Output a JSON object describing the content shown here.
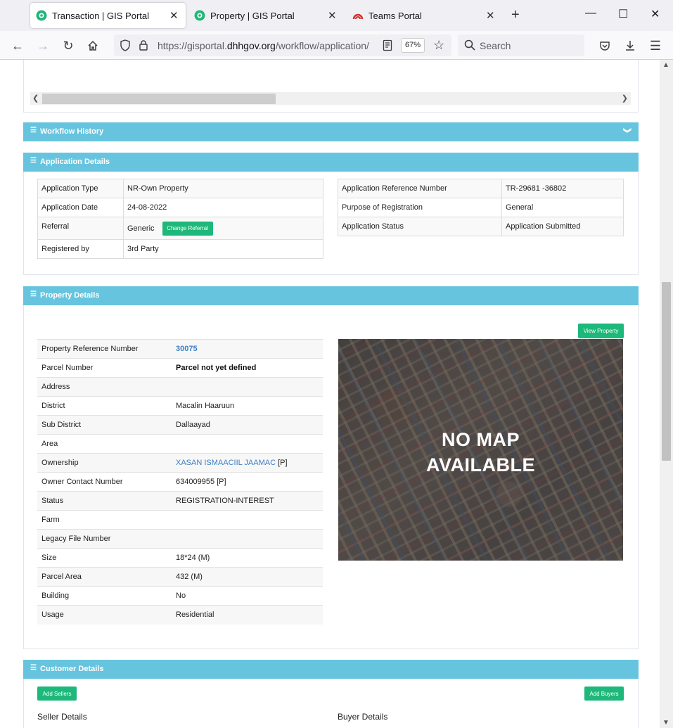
{
  "browser": {
    "tabs": [
      {
        "title": "Transaction | GIS Portal",
        "active": true
      },
      {
        "title": "Property | GIS Portal",
        "active": false
      },
      {
        "title": "Teams Portal",
        "active": false
      }
    ],
    "url_prefix": "https://gisportal.",
    "url_domain": "dhhgov.org",
    "url_path": "/workflow/application/",
    "zoom": "67%",
    "search_placeholder": "Search"
  },
  "workflow_history": {
    "title": "Workflow History"
  },
  "application_details": {
    "title": "Application Details",
    "left": [
      {
        "label": "Application Type",
        "value": "NR-Own Property"
      },
      {
        "label": "Application Date",
        "value": "24-08-2022"
      },
      {
        "label": "Referral",
        "value": "Generic",
        "button": "Change Referral"
      },
      {
        "label": "Registered by",
        "value": "3rd Party"
      }
    ],
    "right": [
      {
        "label": "Application Reference Number",
        "value": "TR-29681 -36802"
      },
      {
        "label": "Purpose of Registration",
        "value": "General"
      },
      {
        "label": "Application Status",
        "value": "Application Submitted"
      }
    ]
  },
  "property_details": {
    "title": "Property Details",
    "view_button": "View Property",
    "map_text_line1": "NO MAP",
    "map_text_line2": "AVAILABLE",
    "rows": [
      {
        "label": "Property Reference Number",
        "value": "30075"
      },
      {
        "label": "Parcel Number",
        "value": "Parcel not yet defined"
      },
      {
        "label": "Address",
        "value": ""
      },
      {
        "label": "District",
        "value": "Macalin Haaruun"
      },
      {
        "label": "Sub District",
        "value": "Dallaayad"
      },
      {
        "label": "Area",
        "value": ""
      },
      {
        "label": "Ownership",
        "value": "XASAN ISMAACIIL JAAMAC",
        "suffix": " [P]"
      },
      {
        "label": "Owner Contact Number",
        "value": "634009955 [P]"
      },
      {
        "label": "Status",
        "value": "REGISTRATION-INTEREST"
      },
      {
        "label": "Farm",
        "value": ""
      },
      {
        "label": "Legacy File Number",
        "value": ""
      },
      {
        "label": "Size",
        "value": "18*24 (M)"
      },
      {
        "label": "Parcel Area",
        "value": "432 (M)"
      },
      {
        "label": "Building",
        "value": "No"
      },
      {
        "label": "Usage",
        "value": "Residential"
      }
    ]
  },
  "customer_details": {
    "title": "Customer Details",
    "add_sellers": "Add Sellers",
    "add_buyers": "Add Buyers",
    "seller_label": "Seller Details",
    "buyer_label": "Buyer Details"
  }
}
